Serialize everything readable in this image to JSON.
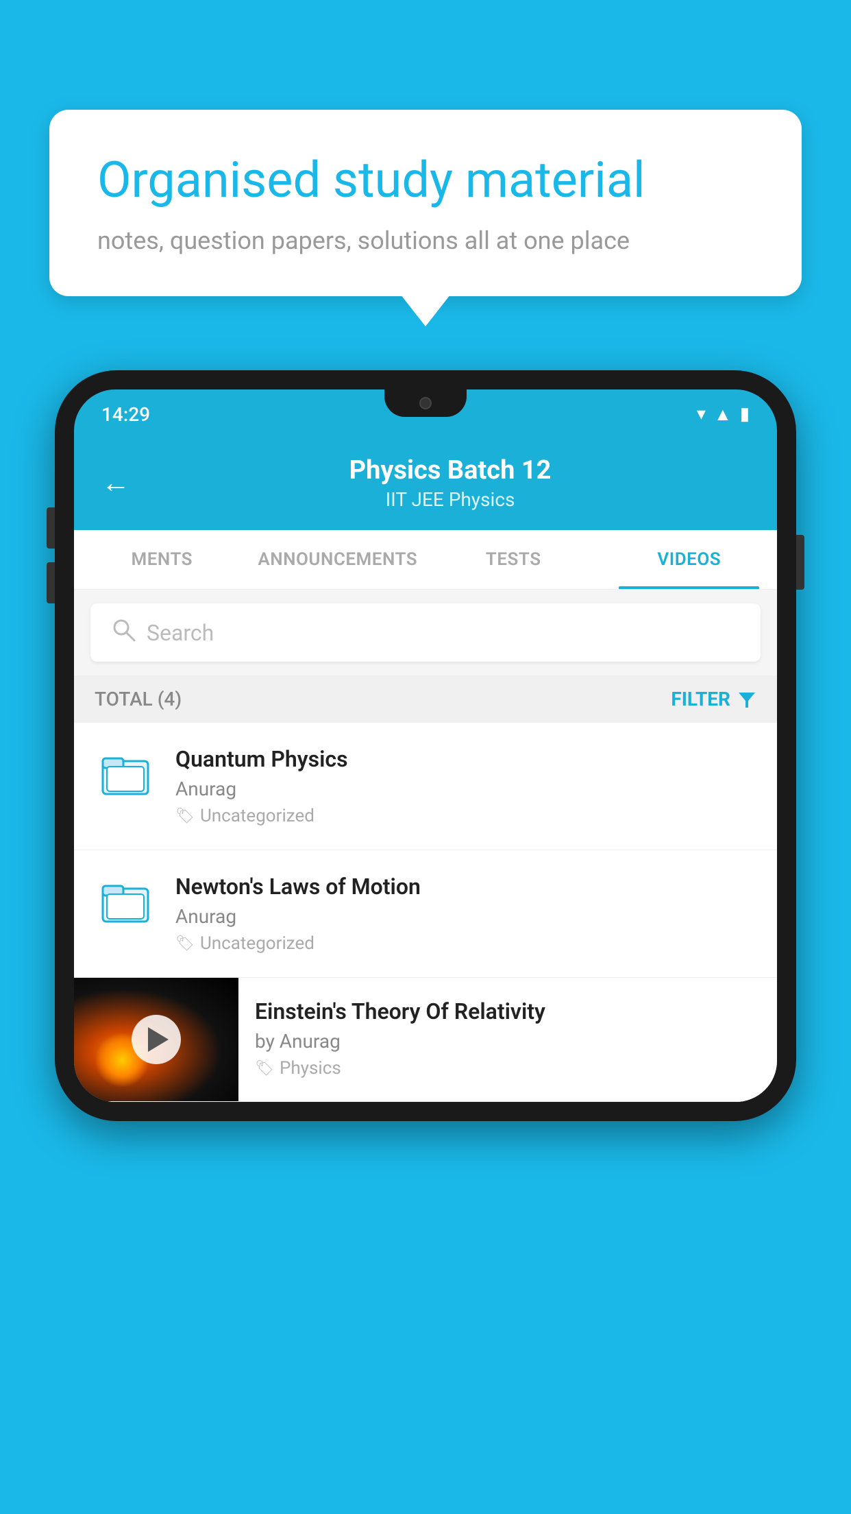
{
  "background": {
    "color": "#1ab8e8"
  },
  "bubble": {
    "title": "Organised study material",
    "subtitle": "notes, question papers, solutions all at one place"
  },
  "phone": {
    "status_bar": {
      "time": "14:29"
    },
    "header": {
      "title": "Physics Batch 12",
      "subtitle": "IIT JEE   Physics",
      "back_label": "←"
    },
    "tabs": [
      {
        "label": "MENTS",
        "active": false
      },
      {
        "label": "ANNOUNCEMENTS",
        "active": false
      },
      {
        "label": "TESTS",
        "active": false
      },
      {
        "label": "VIDEOS",
        "active": true
      }
    ],
    "search": {
      "placeholder": "Search"
    },
    "filter_bar": {
      "total_label": "TOTAL (4)",
      "filter_label": "FILTER"
    },
    "videos": [
      {
        "id": 1,
        "title": "Quantum Physics",
        "author": "Anurag",
        "tag": "Uncategorized",
        "has_thumb": false
      },
      {
        "id": 2,
        "title": "Newton's Laws of Motion",
        "author": "Anurag",
        "tag": "Uncategorized",
        "has_thumb": false
      },
      {
        "id": 3,
        "title": "Einstein's Theory Of Relativity",
        "author": "by Anurag",
        "tag": "Physics",
        "has_thumb": true
      }
    ]
  }
}
